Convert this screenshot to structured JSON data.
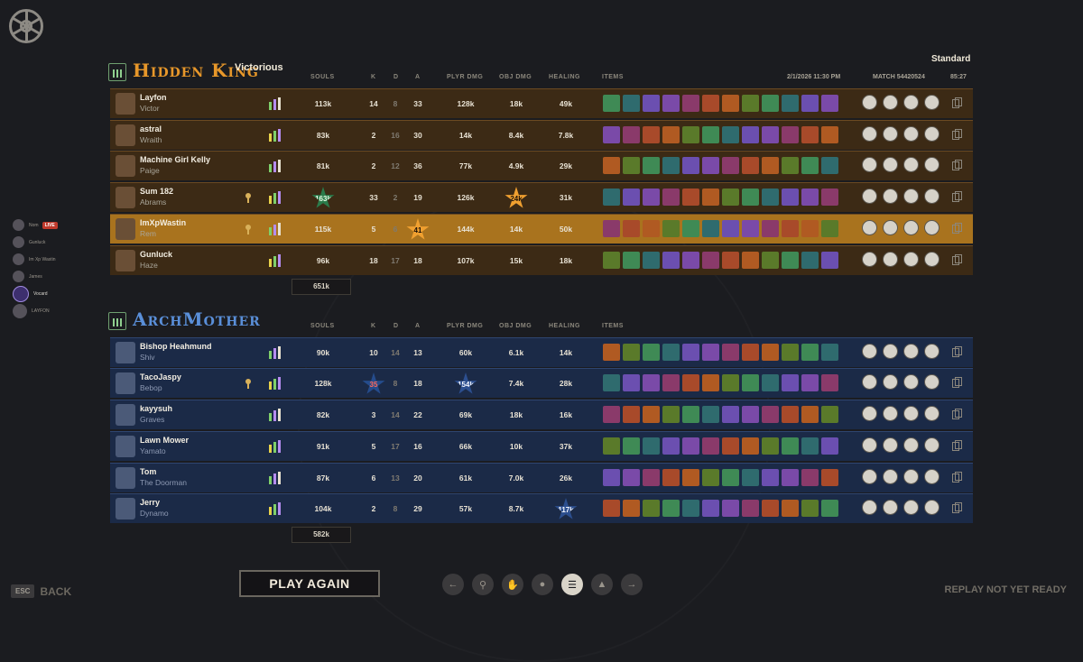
{
  "header": {
    "mode": "Standard",
    "date": "2/1/2026 11:30 PM",
    "match": "MATCH 54420524",
    "duration": "85:27"
  },
  "columns": {
    "souls": "SOULS",
    "k": "K",
    "d": "D",
    "a": "A",
    "plyr": "PLYR DMG",
    "obj": "OBJ DMG",
    "heal": "HEALING",
    "items": "ITEMS"
  },
  "sidebar": {
    "items": [
      {
        "label": "Nom",
        "live": "LIVE"
      },
      {
        "label": "Gunluck"
      },
      {
        "label": "Im Xp Wastin"
      },
      {
        "label": "James"
      },
      {
        "label": "Vocard"
      },
      {
        "label": "LAYFON"
      }
    ]
  },
  "teams": [
    {
      "name": "Hidden King",
      "result": "Victorious",
      "total_souls": "651k",
      "players": [
        {
          "name": "Layfon",
          "hero": "Victor",
          "souls": "113k",
          "k": "14",
          "d": "8",
          "a": "33",
          "plyr": "128k",
          "obj": "18k",
          "heal": "49k"
        },
        {
          "name": "astral",
          "hero": "Wraith",
          "souls": "83k",
          "k": "2",
          "d": "16",
          "a": "30",
          "plyr": "14k",
          "obj": "8.4k",
          "heal": "7.8k"
        },
        {
          "name": "Machine Girl Kelly",
          "hero": "Paige",
          "souls": "81k",
          "k": "2",
          "d": "12",
          "a": "36",
          "plyr": "77k",
          "obj": "4.9k",
          "heal": "29k"
        },
        {
          "name": "Sum 182",
          "hero": "Abrams",
          "souls": "163k",
          "k": "33",
          "d": "2",
          "a": "19",
          "plyr": "126k",
          "obj": "24k",
          "heal": "31k"
        },
        {
          "name": "ImXpWastin",
          "hero": "Rem",
          "souls": "115k",
          "k": "5",
          "d": "6",
          "a": "41",
          "plyr": "144k",
          "obj": "14k",
          "heal": "50k"
        },
        {
          "name": "Gunluck",
          "hero": "Haze",
          "souls": "96k",
          "k": "18",
          "d": "17",
          "a": "18",
          "plyr": "107k",
          "obj": "15k",
          "heal": "18k"
        }
      ]
    },
    {
      "name": "ArchMother",
      "total_souls": "582k",
      "players": [
        {
          "name": "Bishop Heahmund",
          "hero": "Shiv",
          "souls": "90k",
          "k": "10",
          "d": "14",
          "a": "13",
          "plyr": "60k",
          "obj": "6.1k",
          "heal": "14k"
        },
        {
          "name": "TacoJaspy",
          "hero": "Bebop",
          "souls": "128k",
          "k": "35",
          "d": "8",
          "a": "18",
          "plyr": "154k",
          "obj": "7.4k",
          "heal": "28k"
        },
        {
          "name": "kayysuh",
          "hero": "Graves",
          "souls": "82k",
          "k": "3",
          "d": "14",
          "a": "22",
          "plyr": "69k",
          "obj": "18k",
          "heal": "16k"
        },
        {
          "name": "Lawn Mower",
          "hero": "Yamato",
          "souls": "91k",
          "k": "5",
          "d": "17",
          "a": "16",
          "plyr": "66k",
          "obj": "10k",
          "heal": "37k"
        },
        {
          "name": "Tom",
          "hero": "The Doorman",
          "souls": "87k",
          "k": "6",
          "d": "13",
          "a": "20",
          "plyr": "61k",
          "obj": "7.0k",
          "heal": "26k"
        },
        {
          "name": "Jerry",
          "hero": "Dynamo",
          "souls": "104k",
          "k": "2",
          "d": "8",
          "a": "29",
          "plyr": "57k",
          "obj": "8.7k",
          "heal": "117k"
        }
      ]
    }
  ],
  "footer": {
    "esc": "ESC",
    "back": "BACK",
    "play_again": "PLAY AGAIN",
    "replay": "REPLAY NOT YET READY"
  },
  "colors": {
    "amber": "#a9731e",
    "blue": "#1b2a47",
    "green_item": "#3f8a55",
    "purple_item": "#7a4aa8",
    "orange_item": "#b05a22"
  }
}
